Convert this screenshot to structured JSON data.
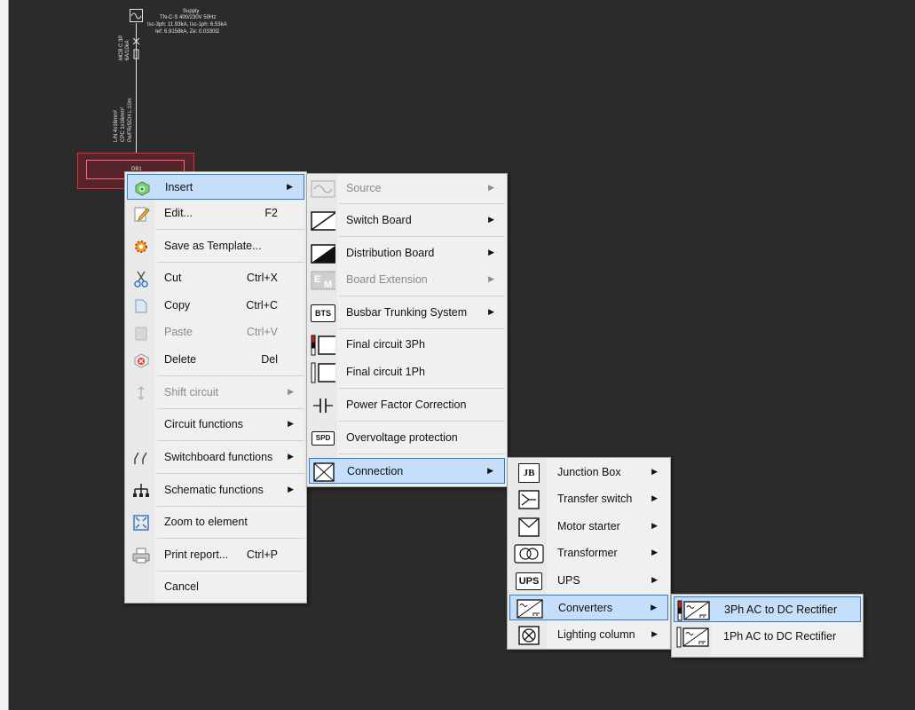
{
  "canvas": {
    "supply_header": "Supply",
    "supply_line1": "TN-C-S  400/230V  50Hz",
    "supply_line2": "Isc-3ph: 11.93kA,  Isc-1ph: 6.53kA",
    "supply_line3": "Ief: 6.9158kA,  Ze: 0.0330Ω",
    "breaker_label": "MCB C 3P",
    "breaker_rating": "6A/10kA",
    "cable_line1": "L/N 4x16mm²",
    "cable_line2": "CPC 1x16mm²",
    "cable_line3": "Pe/FR/SCH L:10m",
    "board_label": "DB1"
  },
  "context_menu": {
    "items": [
      {
        "label": "Insert",
        "icon": "insert-icon",
        "submenu": true,
        "highlighted": true
      },
      {
        "label": "Edit...",
        "shortcut": "F2",
        "icon": "edit-icon"
      },
      {
        "label": "Save as Template...",
        "icon": "template-gear-icon"
      },
      {
        "label": "Cut",
        "shortcut": "Ctrl+X",
        "icon": "scissors-icon"
      },
      {
        "label": "Copy",
        "shortcut": "Ctrl+C",
        "icon": "copy-icon"
      },
      {
        "label": "Paste",
        "shortcut": "Ctrl+V",
        "icon": "paste-icon",
        "disabled": true
      },
      {
        "label": "Delete",
        "shortcut": "Del",
        "icon": "delete-icon"
      },
      {
        "label": "Shift circuit",
        "icon": "shift-icon",
        "submenu": true,
        "disabled": true
      },
      {
        "label": "Circuit functions",
        "submenu": true
      },
      {
        "label": "Switchboard functions",
        "icon": "switch-contacts-icon",
        "submenu": true
      },
      {
        "label": "Schematic functions",
        "icon": "schematic-tree-icon",
        "submenu": true
      },
      {
        "label": "Zoom to element",
        "icon": "zoom-extents-icon"
      },
      {
        "label": "Print report...",
        "shortcut": "Ctrl+P",
        "icon": "printer-icon"
      },
      {
        "label": "Cancel"
      }
    ]
  },
  "insert_menu": {
    "items": [
      {
        "label": "Source",
        "icon": "source-sine-icon",
        "submenu": true,
        "disabled": true
      },
      {
        "label": "Switch Board",
        "icon": "switch-board-icon",
        "submenu": true
      },
      {
        "label": "Distribution Board",
        "icon": "distribution-board-icon",
        "submenu": true
      },
      {
        "label": "Board Extension",
        "icon": "board-extension-icon",
        "submenu": true,
        "disabled": true
      },
      {
        "label": "Busbar Trunking System",
        "icon": "bts-icon",
        "icon_text": "BTS",
        "submenu": true
      },
      {
        "label": "Final circuit 3Ph",
        "icon": "final-circuit-3ph-icon"
      },
      {
        "label": "Final circuit 1Ph",
        "icon": "final-circuit-1ph-icon"
      },
      {
        "label": "Power Factor Correction",
        "icon": "capacitor-icon"
      },
      {
        "label": "Overvoltage protection",
        "icon": "spd-icon",
        "icon_text": "SPD"
      },
      {
        "label": "Connection",
        "icon": "connection-icon",
        "submenu": true,
        "highlighted": true
      }
    ]
  },
  "connection_menu": {
    "items": [
      {
        "label": "Junction Box",
        "icon": "junction-box-icon",
        "icon_text": "JB",
        "submenu": true
      },
      {
        "label": "Transfer switch",
        "icon": "transfer-switch-icon",
        "submenu": true
      },
      {
        "label": "Motor starter",
        "icon": "motor-starter-icon",
        "submenu": true
      },
      {
        "label": "Transformer",
        "icon": "transformer-icon",
        "submenu": true
      },
      {
        "label": "UPS",
        "icon": "ups-icon",
        "icon_text": "UPS",
        "submenu": true
      },
      {
        "label": "Converters",
        "icon": "converter-icon",
        "submenu": true,
        "highlighted": true
      },
      {
        "label": "Lighting column",
        "icon": "lighting-column-icon",
        "submenu": true
      }
    ]
  },
  "converters_menu": {
    "items": [
      {
        "label": "3Ph AC to DC Rectifier",
        "icon": "rectifier-3ph-icon",
        "highlighted": true
      },
      {
        "label": "1Ph AC to DC Rectifier",
        "icon": "rectifier-1ph-icon"
      }
    ]
  },
  "colors": {
    "highlight_bg": "#c5defa",
    "highlight_border": "#2e7dd1",
    "selection_red": "#e0303a",
    "canvas_bg": "#2b2b2b"
  }
}
